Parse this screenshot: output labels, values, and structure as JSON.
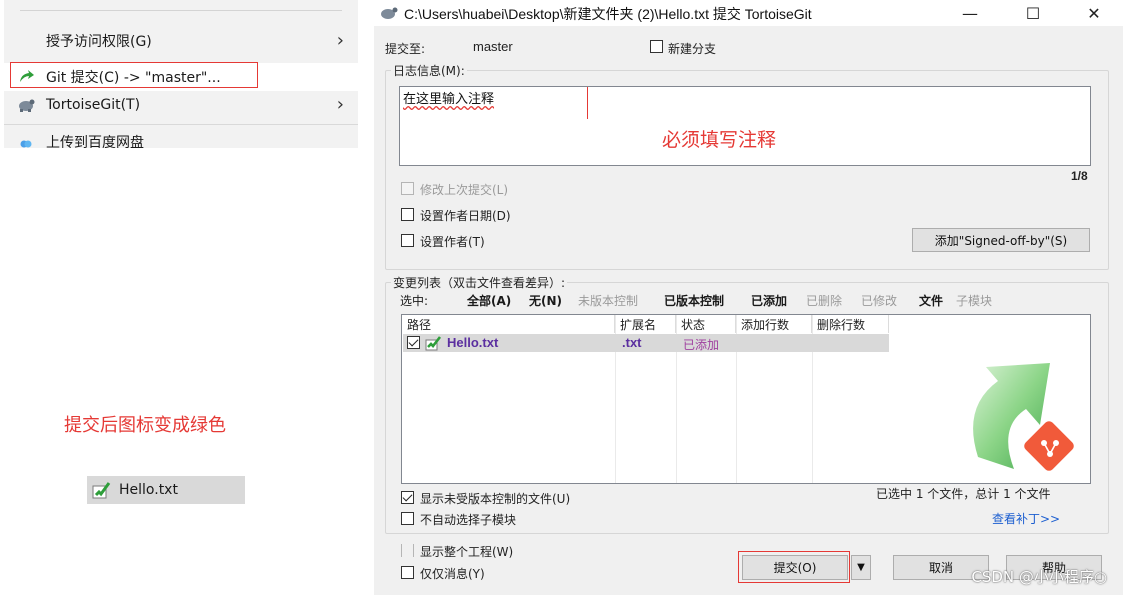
{
  "context_menu": {
    "items": [
      {
        "label": "授予访问权限(G)",
        "icon": "none",
        "has_submenu": true
      },
      {
        "label": "Git 提交(C) -> \"master\"...",
        "icon": "git-commit-icon",
        "has_submenu": false
      },
      {
        "label": "TortoiseGit(T)",
        "icon": "tortoisegit-icon",
        "has_submenu": true
      },
      {
        "label": "上传到百度网盘",
        "icon": "baidu-cloud-icon",
        "has_submenu": false
      }
    ]
  },
  "left_note": "提交后图标变成绿色",
  "file_chip": {
    "name": "Hello.txt",
    "icon": "git-file-added-icon"
  },
  "dialog": {
    "title": "C:\\Users\\huabei\\Desktop\\新建文件夹 (2)\\Hello.txt   提交   TortoiseGit",
    "window_buttons": {
      "minimize": "—",
      "maximize": "☐",
      "close": "✕"
    },
    "commit_to_label": "提交至:",
    "branch": "master",
    "new_branch_label": "新建分支",
    "log_group_title": "日志信息(M):",
    "message_text": "在这里输入注释",
    "message_note": "必须填写注释",
    "line_counter": "1/8",
    "amend_label": "修改上次提交(L)",
    "set_author_date_label": "设置作者日期(D)",
    "set_author_label": "设置作者(T)",
    "signed_off_button": "添加\"Signed-off-by\"(S)",
    "changes_group_title": "变更列表（双击文件查看差异）:",
    "select_label": "选中:",
    "filters": [
      {
        "label": "全部(A)",
        "bold": true
      },
      {
        "label": "无(N)",
        "bold": true
      },
      {
        "label": "未版本控制",
        "bold": false
      },
      {
        "label": "已版本控制",
        "bold": true
      },
      {
        "label": "已添加",
        "bold": true
      },
      {
        "label": "已删除",
        "bold": false
      },
      {
        "label": "已修改",
        "bold": false
      },
      {
        "label": "文件",
        "bold": true
      },
      {
        "label": "子模块",
        "bold": false
      }
    ],
    "columns": [
      "路径",
      "扩展名",
      "状态",
      "添加行数",
      "删除行数"
    ],
    "rows": [
      {
        "path": "Hello.txt",
        "ext": ".txt",
        "status": "已添加",
        "added": "",
        "deleted": "",
        "checked": true
      }
    ],
    "colors": {
      "path_text": "#5b2fa0",
      "ext_text": "#5b2fa0",
      "status_text": "#a040a0",
      "annotation": "#e53935"
    },
    "show_unversioned_label": "显示未受版本控制的文件(U)",
    "no_auto_submodule_label": "不自动选择子模块",
    "selection_summary": "已选中 1 个文件，总计 1 个文件",
    "view_patch_link": "查看补丁>>",
    "show_whole_project_label": "显示整个工程(W)",
    "message_only_label": "仅仅消息(Y)",
    "commit_button": "提交(O)",
    "dropdown_arrow": "▼",
    "cancel_button": "取消",
    "help_button": "帮助"
  },
  "watermark": "CSDN @小小程序○"
}
